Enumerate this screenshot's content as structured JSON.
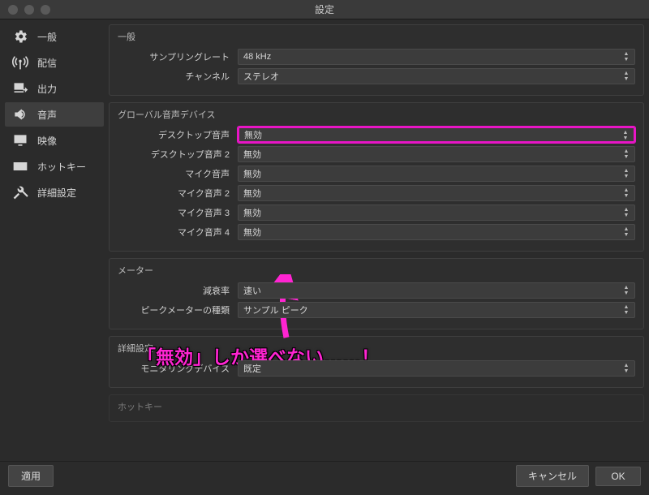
{
  "window": {
    "title": "設定"
  },
  "sidebar": {
    "items": [
      {
        "label": "一般"
      },
      {
        "label": "配信"
      },
      {
        "label": "出力"
      },
      {
        "label": "音声"
      },
      {
        "label": "映像"
      },
      {
        "label": "ホットキー"
      },
      {
        "label": "詳細設定"
      }
    ]
  },
  "sections": {
    "general": {
      "title": "一般",
      "sampling_rate": {
        "label": "サンプリングレート",
        "value": "48 kHz"
      },
      "channels": {
        "label": "チャンネル",
        "value": "ステレオ"
      }
    },
    "global_audio": {
      "title": "グローバル音声デバイス",
      "desktop_audio_1": {
        "label": "デスクトップ音声",
        "value": "無効"
      },
      "desktop_audio_2": {
        "label": "デスクトップ音声 2",
        "value": "無効"
      },
      "mic_audio_1": {
        "label": "マイク音声",
        "value": "無効"
      },
      "mic_audio_2": {
        "label": "マイク音声 2",
        "value": "無効"
      },
      "mic_audio_3": {
        "label": "マイク音声 3",
        "value": "無効"
      },
      "mic_audio_4": {
        "label": "マイク音声 4",
        "value": "無効"
      }
    },
    "meter": {
      "title": "メーター",
      "decay": {
        "label": "減衰率",
        "value": "速い"
      },
      "peak_type": {
        "label": "ピークメーターの種類",
        "value": "サンプル ピーク"
      }
    },
    "advanced": {
      "title": "詳細設定",
      "monitoring_device": {
        "label": "モニタリングデバイス",
        "value": "既定"
      }
    },
    "hotkey": {
      "title": "ホットキー"
    }
  },
  "footer": {
    "apply": "適用",
    "cancel": "キャンセル",
    "ok": "OK"
  },
  "annotation": {
    "text": "「無効」しか選べない……！"
  }
}
